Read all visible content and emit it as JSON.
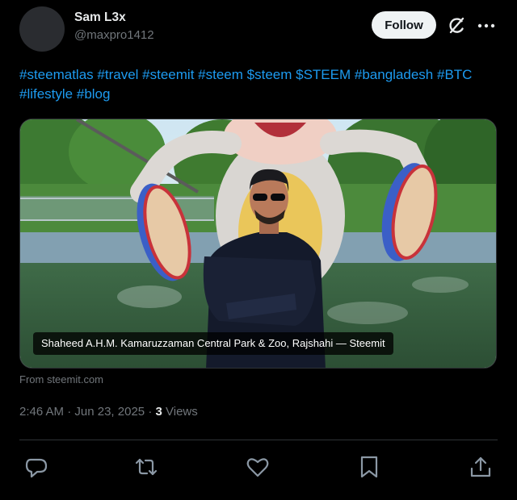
{
  "post": {
    "author": {
      "display_name": "Sam L3x",
      "handle": "@maxpro1412"
    },
    "follow_label": "Follow",
    "hashtags": [
      "#steematlas",
      "#travel",
      "#steemit",
      "#steem",
      "$steem",
      "$STEEM",
      "#bangladesh",
      "#BTC",
      "#lifestyle",
      "#blog"
    ],
    "link_card": {
      "caption": "Shaheed A.H.M. Kamaruzzaman Central Park & Zoo, Rajshahi — Steemit",
      "source": "From steemit.com"
    },
    "time": "2:46 AM",
    "date": "Jun 23, 2025",
    "views_count": "3",
    "views_label": "Views"
  },
  "icons": {
    "header": [
      "grok-icon",
      "more-icon"
    ],
    "actions": [
      "reply-icon",
      "repost-icon",
      "like-icon",
      "bookmark-icon",
      "share-icon"
    ]
  },
  "colors": {
    "background": "#000000",
    "link_blue": "#1d9bf0",
    "primary_text": "#e7e9ea",
    "secondary_text": "#71767b",
    "follow_button_bg": "#eff3f4"
  }
}
